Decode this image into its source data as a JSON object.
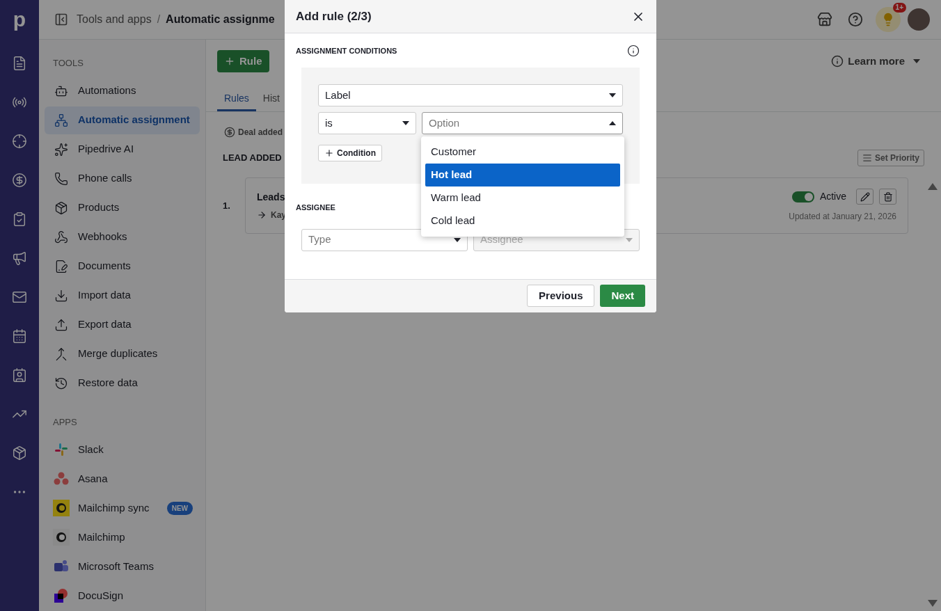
{
  "logo": "p",
  "header": {
    "breadcrumb": [
      "Tools and apps",
      "Automatic assignme"
    ],
    "separator": "/",
    "notification_count": "1+"
  },
  "sidebar": {
    "sections": [
      {
        "title": "TOOLS",
        "items": [
          {
            "label": "Automations",
            "selected": false
          },
          {
            "label": "Automatic assignment",
            "selected": true
          },
          {
            "label": "Pipedrive AI",
            "selected": false
          },
          {
            "label": "Phone calls",
            "selected": false
          },
          {
            "label": "Products",
            "selected": false
          },
          {
            "label": "Webhooks",
            "selected": false
          },
          {
            "label": "Documents",
            "selected": false
          },
          {
            "label": "Import data",
            "selected": false
          },
          {
            "label": "Export data",
            "selected": false
          },
          {
            "label": "Merge duplicates",
            "selected": false
          },
          {
            "label": "Restore data",
            "selected": false
          }
        ]
      },
      {
        "title": "APPS",
        "items": [
          {
            "label": "Slack",
            "selected": false
          },
          {
            "label": "Asana",
            "selected": false
          },
          {
            "label": "Mailchimp sync",
            "selected": false,
            "badge": "NEW"
          },
          {
            "label": "Mailchimp",
            "selected": false
          },
          {
            "label": "Microsoft Teams",
            "selected": false
          },
          {
            "label": "DocuSign",
            "selected": false
          }
        ]
      }
    ]
  },
  "main": {
    "add_button": "Rule",
    "learn_more": "Learn more",
    "tabs": [
      {
        "label": "Rules",
        "selected": true
      },
      {
        "label": "Hist",
        "selected": false
      }
    ],
    "filter": "Deal added",
    "section": "LEAD ADDED",
    "set_priority": "Set Priority",
    "rule": {
      "index": "1.",
      "title": "Leads",
      "subtitle": "Kay",
      "active": true,
      "status": "Active",
      "updated": "Updated at January 21, 2026"
    }
  },
  "modal": {
    "title": "Add rule (2/3)",
    "conditions_heading": "ASSIGNMENT CONDITIONS",
    "field": "Label",
    "operator": "is",
    "value_placeholder": "Option",
    "expanded": true,
    "options": [
      {
        "label": "Customer",
        "selected": false
      },
      {
        "label": "Hot lead",
        "selected": true
      },
      {
        "label": "Warm lead",
        "selected": false
      },
      {
        "label": "Cold lead",
        "selected": false
      }
    ],
    "add_condition": "Condition",
    "assignee_heading": "ASSIGNEE",
    "type_placeholder": "Type",
    "assignee_placeholder": "Assignee",
    "assignee_disabled": true,
    "buttons": {
      "previous": "Previous",
      "next": "Next"
    }
  }
}
